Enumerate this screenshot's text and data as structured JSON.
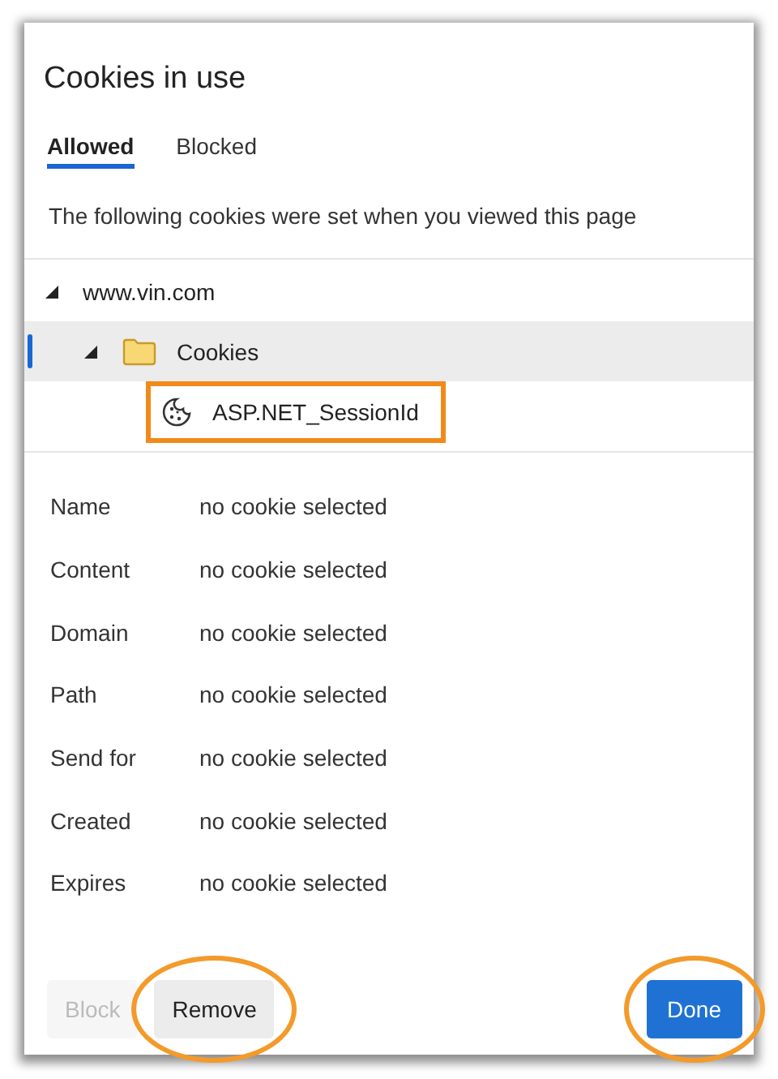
{
  "dialog": {
    "title": "Cookies in use"
  },
  "tabs": [
    {
      "label": "Allowed",
      "selected": true
    },
    {
      "label": "Blocked",
      "selected": false
    }
  ],
  "description": "The following cookies were set when you viewed this page",
  "tree": [
    {
      "label": "www.vin.com",
      "expanded": true,
      "selected": false,
      "highlighted": false,
      "children": [
        {
          "label": "Cookies",
          "kind": "folder",
          "expanded": true,
          "selected": true,
          "highlighted": false,
          "children": [
            {
              "label": "ASP.NET_SessionId",
              "kind": "cookie",
              "selected": false,
              "highlighted": true
            }
          ]
        }
      ]
    }
  ],
  "details": [
    {
      "label": "Name",
      "value": "no cookie selected"
    },
    {
      "label": "Content",
      "value": "no cookie selected"
    },
    {
      "label": "Domain",
      "value": "no cookie selected"
    },
    {
      "label": "Path",
      "value": "no cookie selected"
    },
    {
      "label": "Send for",
      "value": "no cookie selected"
    },
    {
      "label": "Created",
      "value": "no cookie selected"
    },
    {
      "label": "Expires",
      "value": "no cookie selected"
    }
  ],
  "buttons": [
    {
      "label": "Block",
      "kind": "secondary",
      "disabled": true,
      "highlighted": false
    },
    {
      "label": "Remove",
      "kind": "secondary",
      "disabled": false,
      "highlighted": true
    },
    {
      "label": "Done",
      "kind": "primary",
      "disabled": false,
      "highlighted": true
    }
  ]
}
